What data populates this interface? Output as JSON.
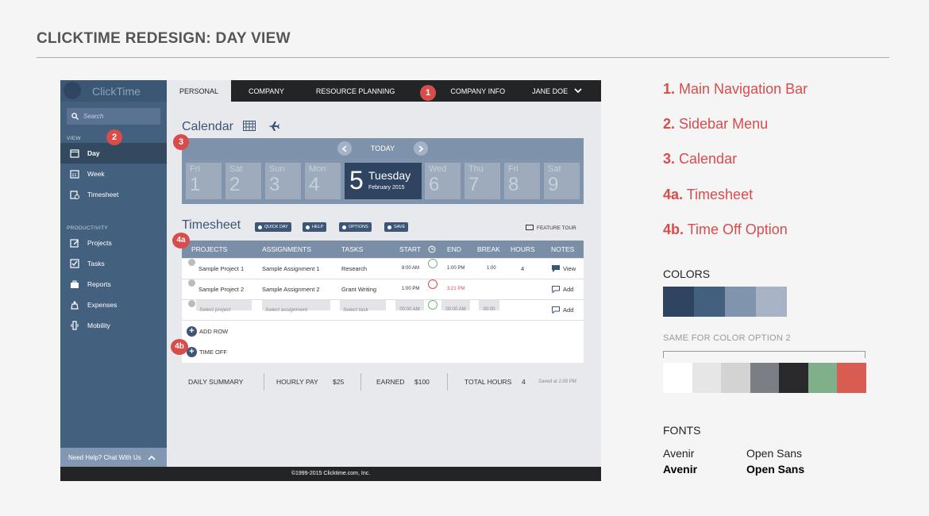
{
  "page_title": "CLICKTIME REDESIGN: DAY VIEW",
  "app": {
    "logo": "ClickTime",
    "search_placeholder": "Search",
    "sidebar": {
      "view_heading": "VIEW",
      "view_items": [
        {
          "label": "Day",
          "icon": "calendar-day-icon",
          "active": true
        },
        {
          "label": "Week",
          "icon": "calendar-week-icon"
        },
        {
          "label": "Timesheet",
          "icon": "timesheet-icon"
        }
      ],
      "productivity_heading": "PRODUCTIVITY",
      "productivity_items": [
        {
          "label": "Projects",
          "icon": "edit-icon"
        },
        {
          "label": "Tasks",
          "icon": "checkbox-icon"
        },
        {
          "label": "Reports",
          "icon": "briefcase-icon"
        },
        {
          "label": "Expenses",
          "icon": "money-icon"
        },
        {
          "label": "Mobility",
          "icon": "mobile-icon"
        }
      ],
      "help": "Need Help? Chat With Us"
    },
    "nav": {
      "tabs": [
        "PERSONAL",
        "COMPANY",
        "RESOURCE PLANNING",
        "COMPANY INFO"
      ],
      "user": "JANE DOE"
    },
    "calendar": {
      "title": "Calendar",
      "today_label": "TODAY",
      "days": [
        {
          "name": "Fri",
          "num": "1"
        },
        {
          "name": "Sat",
          "num": "2"
        },
        {
          "name": "Sun",
          "num": "3"
        },
        {
          "name": "Mon",
          "num": "4"
        },
        {
          "name": "Tuesday",
          "num": "5",
          "month": "February 2015",
          "today": true
        },
        {
          "name": "Wed",
          "num": "6"
        },
        {
          "name": "Thu",
          "num": "7"
        },
        {
          "name": "Fri",
          "num": "8"
        },
        {
          "name": "Sat",
          "num": "9"
        }
      ]
    },
    "timesheet": {
      "title": "Timesheet",
      "buttons": [
        "QUICK DAY",
        "HELP",
        "OPTIONS",
        "SAVE"
      ],
      "feature_tour": "FEATURE TOUR",
      "columns": [
        "PROJECTS",
        "ASSIGNMENTS",
        "TASKS",
        "START",
        "END",
        "BREAK",
        "HOURS",
        "NOTES"
      ],
      "rows": [
        {
          "project": "Sample Project 1",
          "assignment": "Sample Assignment 1",
          "task": "Research",
          "start": "8:00 AM",
          "end": "1:00 PM",
          "break": "1:00",
          "hours": "4",
          "note": "View"
        },
        {
          "project": "Sample Project 2",
          "assignment": "Sample Assignment 2",
          "task": "Grant Writing",
          "start": "1:00 PM",
          "end": "3:21 PM",
          "break": "",
          "hours": "",
          "note": "Add"
        }
      ],
      "empty_row": {
        "project": "Select project",
        "assignment": "Select assignment",
        "task": "Select task",
        "start": "00:00 AM",
        "end": "00:00 AM",
        "break": "00:00",
        "note": "Add"
      },
      "add_row": "ADD ROW",
      "time_off": "TIME OFF"
    },
    "summary": {
      "daily": "DAILY SUMMARY",
      "hourly_label": "HOURLY PAY",
      "hourly_value": "$25",
      "earned_label": "EARNED",
      "earned_value": "$100",
      "total_label": "TOTAL HOURS",
      "total_value": "4",
      "saved": "Saved at 1:00 PM"
    },
    "footer": "©1999-2015 Clicktime.com, Inc."
  },
  "badges": [
    "1",
    "2",
    "3",
    "4a",
    "4b"
  ],
  "legend": [
    {
      "num": "1.",
      "text": "Main Navigation Bar"
    },
    {
      "num": "2.",
      "text": "Sidebar Menu"
    },
    {
      "num": "3.",
      "text": "Calendar"
    },
    {
      "num": "4a.",
      "text": "Timesheet"
    },
    {
      "num": "4b.",
      "text": "Time Off Option"
    }
  ],
  "colors_label": "COLORS",
  "colors": [
    "#2f4461",
    "#44607f",
    "#8094ad",
    "#a8b4c6"
  ],
  "colors2_label": "SAME FOR COLOR OPTION 2",
  "colors2": [
    "#ffffff",
    "#e6e6e7",
    "#d3d3d4",
    "#7b7e84",
    "#2a2a2c",
    "#80b08a",
    "#d95c53"
  ],
  "fonts_label": "FONTS",
  "fonts": [
    "Avenir",
    "Open Sans",
    "Avenir",
    "Open Sans"
  ]
}
